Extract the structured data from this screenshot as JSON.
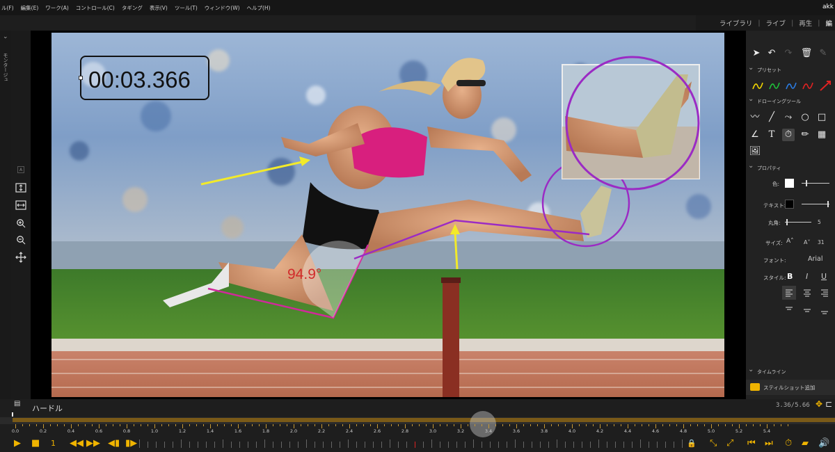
{
  "menu": [
    "ル(F)",
    "編集(E)",
    "ワーク(A)",
    "コントロール(C)",
    "タギング",
    "表示(V)",
    "ツール(T)",
    "ウィンドウ(W)",
    "ヘルプ(H)"
  ],
  "user": "akk",
  "nav": {
    "library": "ライブラリ",
    "live": "ライブ",
    "play": "再生",
    "cut": "編"
  },
  "left_vertical_label": "モンタージュ",
  "timer": "00:03.366",
  "angle": "94.9°",
  "panel": {
    "preset_header": "プリセット",
    "drawing_header": "ドローイングツール",
    "properties_header": "プロパティ",
    "color_label": "色:",
    "text_label": "テキスト:",
    "radius_label": "丸角:",
    "radius_value": "5",
    "size_label": "サイズ:",
    "size_value": "31",
    "font_label": "フォント:",
    "font_value": "Arial",
    "style_label": "スタイル:",
    "timeline_header": "タイムライン",
    "snapshot_label": "スティルショット追加"
  },
  "clip_title": "ハードル",
  "time_readout": "3.36/5.66",
  "frame_number": "1",
  "tick_labels": [
    "0.0",
    "0.2",
    "0.4",
    "0.6",
    "0.8",
    "1.0",
    "1.2",
    "1.4",
    "1.6",
    "1.8",
    "2.0",
    "2.2",
    "2.4",
    "2.6",
    "2.8",
    "3.0",
    "3.2",
    "3.4",
    "3.6",
    "3.8",
    "4.0",
    "4.2",
    "4.4",
    "4.6",
    "4.8",
    "5.0",
    "5.2",
    "5.4"
  ],
  "playhead_seconds": 3.36,
  "duration_seconds": 5.66,
  "colors": {
    "accent": "#f0b400",
    "annotation_magenta": "#d0299a",
    "annotation_purple": "#9b2bc4",
    "arrow_yellow": "#f2ea2a"
  }
}
